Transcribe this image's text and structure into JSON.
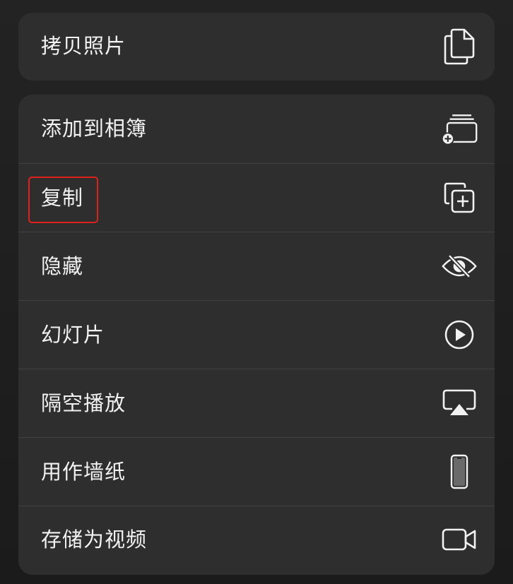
{
  "menu": {
    "copy_photo": {
      "label": "拷贝照片",
      "icon": "copy-photo-icon"
    },
    "items": [
      {
        "label": "添加到相簿",
        "icon": "add-to-album-icon"
      },
      {
        "label": "复制",
        "icon": "duplicate-icon"
      },
      {
        "label": "隐藏",
        "icon": "eye-slash-icon"
      },
      {
        "label": "幻灯片",
        "icon": "play-circle-icon"
      },
      {
        "label": "隔空播放",
        "icon": "airplay-icon"
      },
      {
        "label": "用作墙纸",
        "icon": "iphone-icon"
      },
      {
        "label": "存储为视频",
        "icon": "video-camera-icon"
      }
    ]
  },
  "colors": {
    "background": "#1f1f1f",
    "panel": "#2f2e2e",
    "separator": "#424141",
    "text": "#f2f2f2",
    "highlight": "#e0211b"
  }
}
